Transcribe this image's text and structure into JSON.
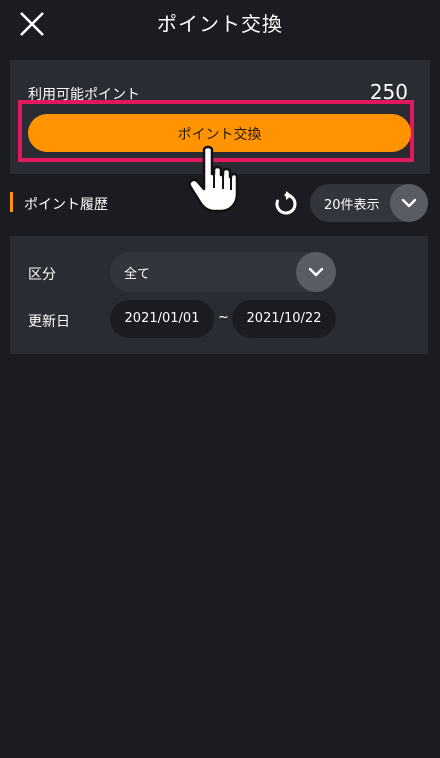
{
  "header": {
    "title": "ポイント交換",
    "close_icon": "close-icon"
  },
  "points": {
    "label": "利用可能ポイント",
    "value": "250",
    "exchange_button": "ポイント交換"
  },
  "history": {
    "title": "ポイント履歴",
    "refresh_icon": "refresh-icon",
    "count_select": "20件表示"
  },
  "filter": {
    "category_label": "区分",
    "category_value": "全て",
    "date_label": "更新日",
    "date_from": "2021/01/01",
    "date_separator": "~",
    "date_to": "2021/10/22"
  },
  "colors": {
    "background": "#1b1c21",
    "panel": "#2a2c33",
    "accent": "#ff9400",
    "highlight": "#e2175f"
  }
}
